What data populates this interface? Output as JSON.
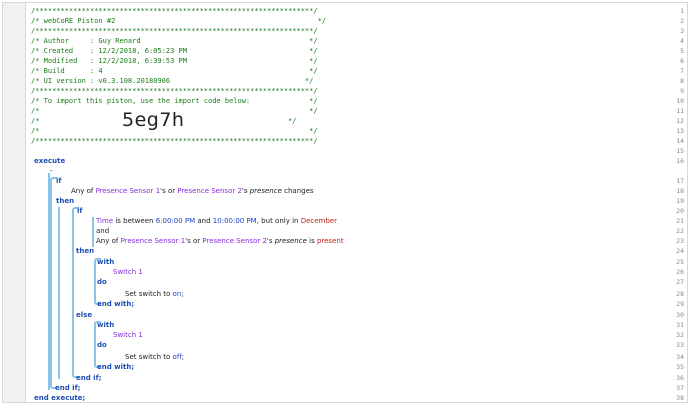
{
  "header_comment": {
    "line1": "/******************************************************************/",
    "title": "/* webCoRE Piston #2                                                */",
    "line3": "/******************************************************************/",
    "author": "/* Author     : Guy Renard                                        */",
    "created": "/* Created    : 12/2/2018, 6:05:23 PM                             */",
    "modified": "/* Modified   : 12/2/2018, 6:39:53 PM                             */",
    "build": "/* Build      : 4                                                 */",
    "ui_version": "/* UI version : v0.3.108.20180906                                */",
    "line9": "/******************************************************************/",
    "import_note": "/* To import this piston, use the import code below:              */",
    "blank1": "/*                                                                */",
    "code_prefix": "/*",
    "code_suffix": "*/",
    "blank2": "/*                                                                */",
    "line14": "/******************************************************************/",
    "import_code": "5eg7h"
  },
  "line_numbers": [
    "1",
    "2",
    "3",
    "4",
    "5",
    "6",
    "7",
    "8",
    "9",
    "10",
    "11",
    "12",
    "13",
    "14",
    "15",
    "16",
    "17",
    "18",
    "19",
    "20",
    "21",
    "22",
    "23",
    "24",
    "25",
    "26",
    "27",
    "28",
    "29",
    "30",
    "31",
    "32",
    "33",
    "34",
    "35",
    "36",
    "37",
    "38"
  ],
  "code": {
    "execute": "execute",
    "dash": "-",
    "if1": "if",
    "cond1_prefix": "Any of ",
    "cond1_dev1": "Presence Sensor 1",
    "cond1_mid": "'s or ",
    "cond1_dev2": "Presence Sensor 2",
    "cond1_possessive": "'s ",
    "cond1_attr": "presence",
    "cond1_op": " changes",
    "then1": "then",
    "if2": "if",
    "cond2_time": "Time",
    "cond2_between": " is between ",
    "cond2_start": "6:00:00 PM",
    "cond2_and": " and ",
    "cond2_end": "10:00:00 PM",
    "cond2_only": ", but only in ",
    "cond2_month": "December",
    "and_kw": "and",
    "cond3_prefix": "Any of ",
    "cond3_dev1": "Presence Sensor 1",
    "cond3_mid": "'s or ",
    "cond3_dev2": "Presence Sensor 2",
    "cond3_possessive": "'s ",
    "cond3_attr": "presence",
    "cond3_is": " is ",
    "cond3_value": "present",
    "then2": "then",
    "with1": "with",
    "switch1_a": "Switch 1",
    "do1": "do",
    "set_on_prefix": "Set switch to ",
    "set_on_value": "on",
    "set_suffix": ";",
    "endwith1": "end with;",
    "else": "else",
    "with2": "with",
    "switch1_b": "Switch 1",
    "do2": "do",
    "set_off_prefix": "Set switch to ",
    "set_off_value": "off",
    "endwith2": "end with;",
    "endif_inner": "end if;",
    "endif_outer": "end if;",
    "end_execute": "end execute;"
  },
  "colors": {
    "comment": "#1a7a1a",
    "keyword": "#1d4fb4",
    "device": "#8a2be2",
    "value": "#1f3fd0",
    "highlight": "#c0221b",
    "guide": "#8ac2e8"
  }
}
